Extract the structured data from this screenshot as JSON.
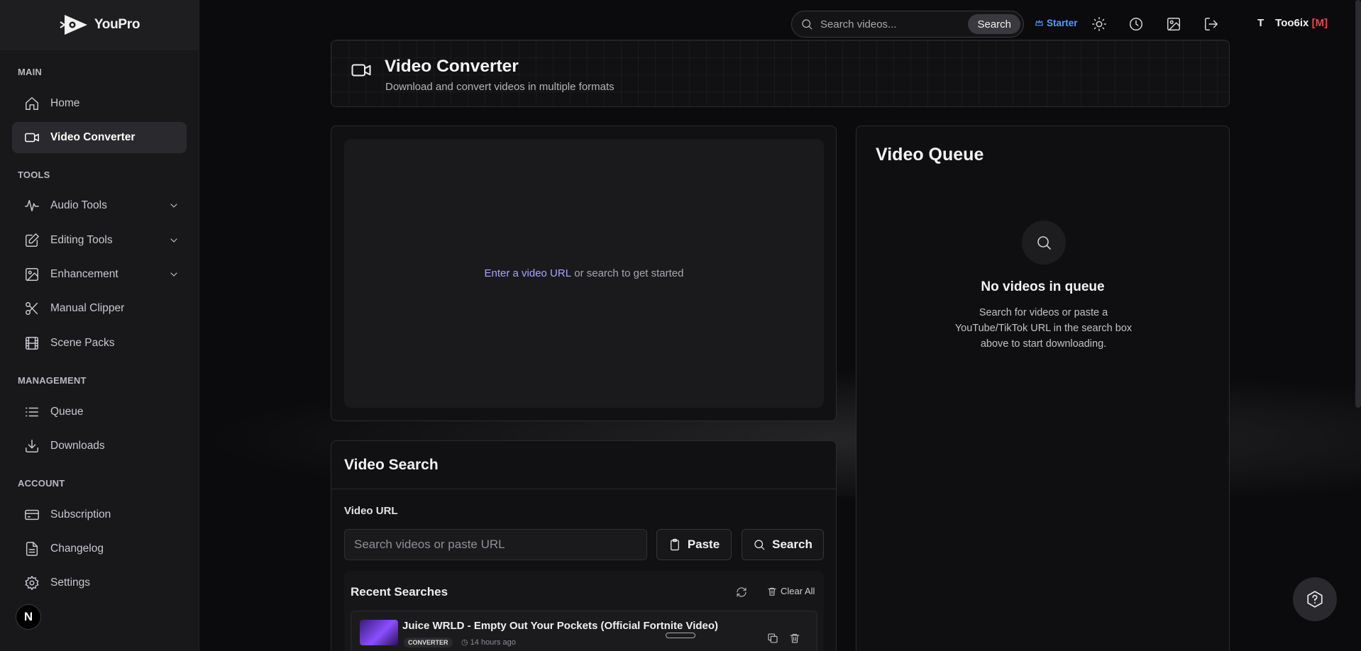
{
  "brand": {
    "name": "YouPro"
  },
  "sidebar": {
    "sections": [
      {
        "label": "MAIN"
      },
      {
        "label": "TOOLS"
      },
      {
        "label": "MANAGEMENT"
      },
      {
        "label": "ACCOUNT"
      }
    ],
    "items": [
      {
        "label": "Home",
        "icon": "home-icon"
      },
      {
        "label": "Video Converter",
        "icon": "video-camera-icon",
        "active": true
      },
      {
        "label": "Audio Tools",
        "icon": "audio-wave-icon",
        "expandable": true
      },
      {
        "label": "Editing Tools",
        "icon": "edit-icon",
        "expandable": true
      },
      {
        "label": "Enhancement",
        "icon": "image-icon",
        "expandable": true
      },
      {
        "label": "Manual Clipper",
        "icon": "scissors-icon"
      },
      {
        "label": "Scene Packs",
        "icon": "film-icon"
      },
      {
        "label": "Queue",
        "icon": "list-icon"
      },
      {
        "label": "Downloads",
        "icon": "download-icon"
      },
      {
        "label": "Subscription",
        "icon": "credit-card-icon"
      },
      {
        "label": "Changelog",
        "icon": "document-icon"
      },
      {
        "label": "Settings",
        "icon": "gear-icon"
      }
    ],
    "badge": "N"
  },
  "topbar": {
    "search_placeholder": "Search videos...",
    "search_button": "Search",
    "plan": "Starter",
    "user_initial": "T",
    "user_name": "Too6ix",
    "user_tag": "[M]"
  },
  "header": {
    "title": "Video Converter",
    "subtitle": "Download and convert videos in multiple formats"
  },
  "preview": {
    "prompt_link": "Enter a video URL",
    "prompt_rest": " or search to get started"
  },
  "video_search": {
    "title": "Video Search",
    "url_label": "Video URL",
    "url_placeholder": "Search videos or paste URL",
    "paste_label": "Paste",
    "search_label": "Search",
    "recent_title": "Recent Searches",
    "clear_all": "Clear All",
    "recent_items": [
      {
        "title": "Juice WRLD - Empty Out Your Pockets (Official Fortnite Video)",
        "tag": "CONVERTER",
        "time": "14 hours ago"
      }
    ]
  },
  "queue": {
    "title": "Video Queue",
    "empty_title": "No videos in queue",
    "empty_desc": "Search for videos or paste a YouTube/TikTok URL in the search box above to start downloading."
  },
  "colors": {
    "accent_blue": "#5b9bff",
    "accent_red": "#e5484d",
    "link_purple": "#a8a5ff"
  }
}
